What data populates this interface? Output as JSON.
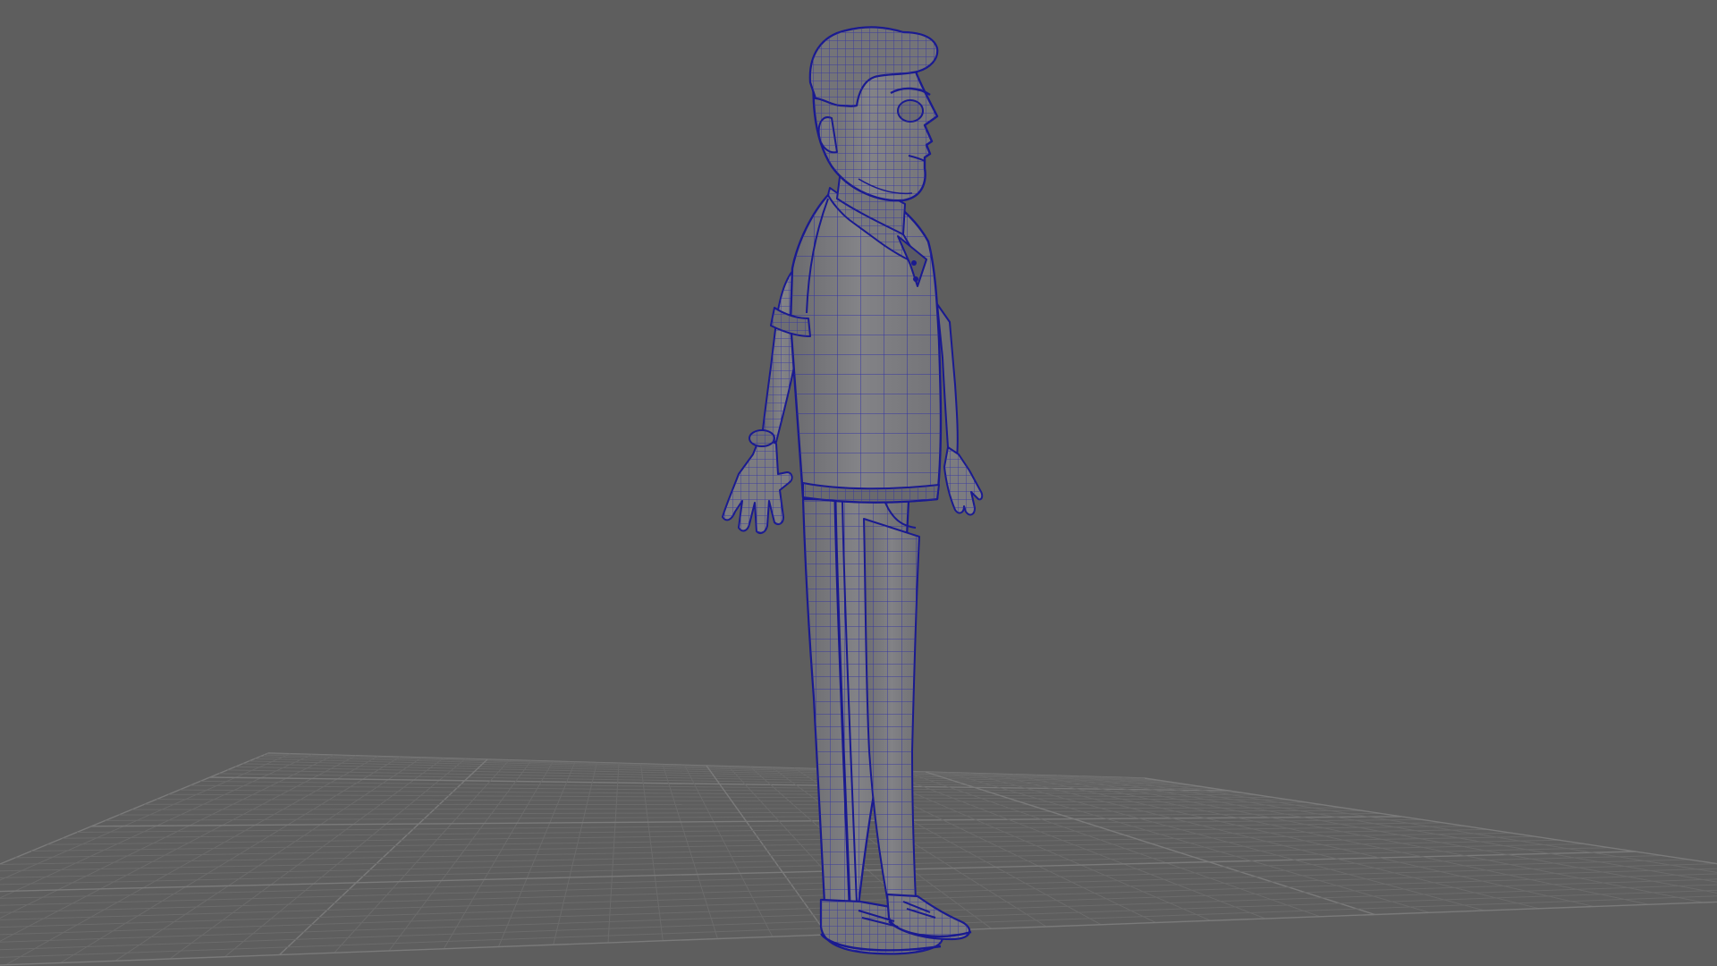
{
  "viewport": {
    "background": "#5e5e5e",
    "grid_line_color": "#6b6b6b",
    "grid_major_color": "#7a7a7a",
    "mesh_surface_color": "#7c7c7f",
    "mesh_shadow_color": "#58585d",
    "wireframe_color": "#2a2aa8",
    "wireframe_outline_color": "#1a1a90",
    "shading_mode": "wireframe-on-shaded",
    "subject": "t-pose-character-mesh"
  }
}
